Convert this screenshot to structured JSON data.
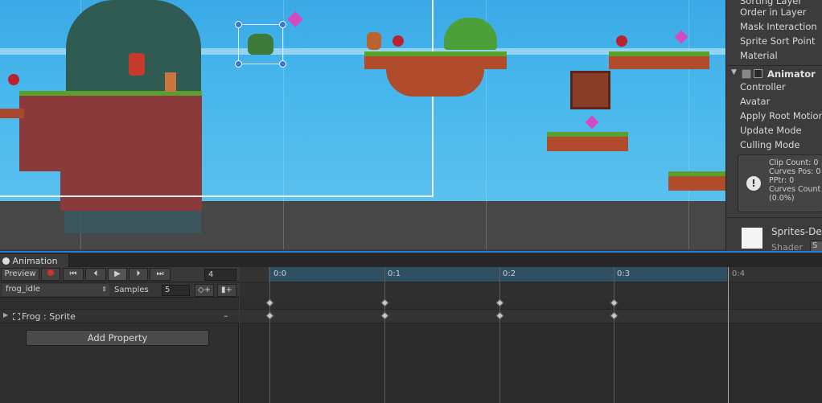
{
  "scene": {
    "label": "Game scene view"
  },
  "inspector": {
    "rows": [
      "Sorting Layer",
      "Order in Layer",
      "Mask Interaction",
      "Sprite Sort Point",
      "Material"
    ],
    "animator_title": "Animator",
    "animator_rows": [
      "Controller",
      "Avatar",
      "Apply Root Motion",
      "Update Mode",
      "Culling Mode"
    ],
    "info_lines": [
      "Clip Count: 0",
      "Curves Pos: 0",
      "PPtr: 0",
      "Curves Count",
      "(0.0%)"
    ],
    "material_name": "Sprites-De",
    "shader_label": "Shader",
    "shader_value": "S"
  },
  "animation": {
    "tab_label": "Animation",
    "preview_label": "Preview",
    "frame_value": "4",
    "clip_name": "frog_idle",
    "samples_label": "Samples",
    "samples_value": "5",
    "property_label": "Frog : Sprite",
    "add_property_label": "Add Property",
    "ruler": [
      "0:0",
      "0:1",
      "0:2",
      "0:3",
      "0:4"
    ]
  },
  "colors": {
    "accent": "#2d7dd8",
    "record": "#d23232",
    "sky": "#46b6ec",
    "grass": "#5aa02c"
  }
}
